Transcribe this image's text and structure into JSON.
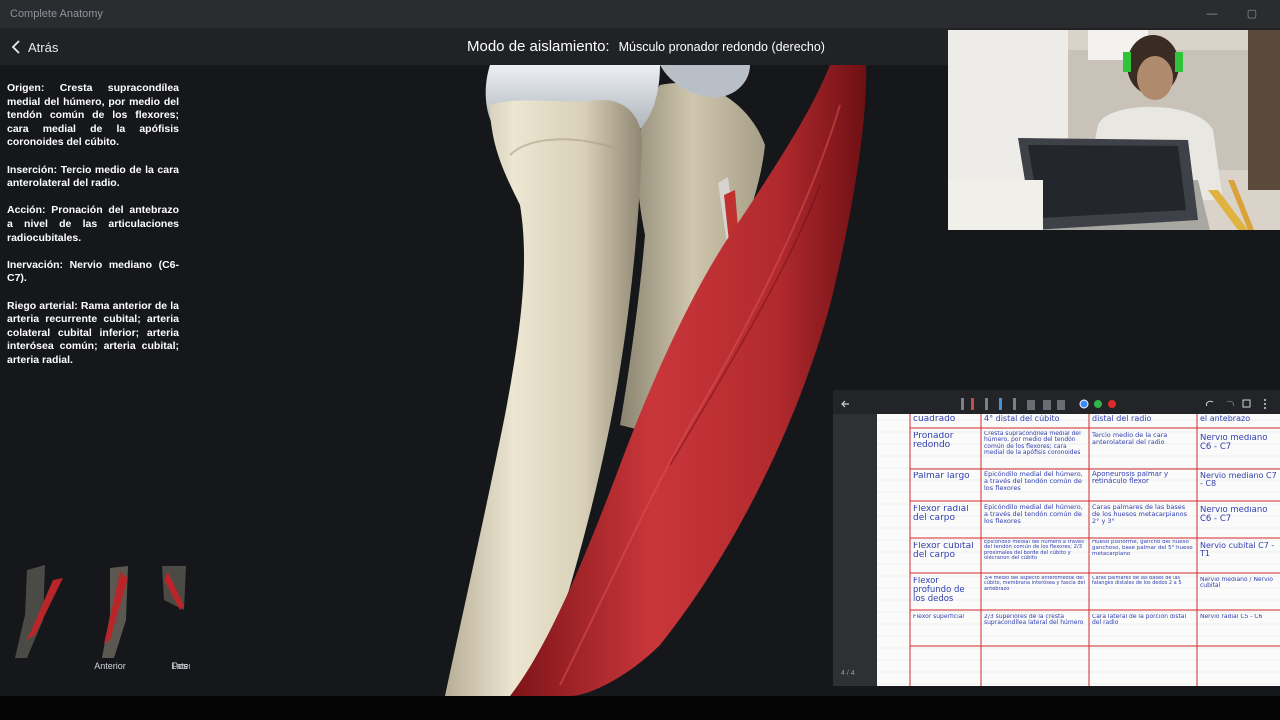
{
  "app_title": "Complete Anatomy",
  "window_controls": {
    "minimize": "—",
    "restore": "▢"
  },
  "header": {
    "back_label": "Atrás",
    "mode_label": "Modo de aislamiento:",
    "structure_label": "Músculo pronador redondo (derecho)"
  },
  "info_panel": [
    "Origen: Cresta supracondílea medial del húmero, por medio del tendón común de los flexores; cara medial de la apófisis coronoides del cúbito.",
    "Inserción: Tercio medio de la cara anterolateral del radio.",
    "Acción: Pronación del antebrazo a nivel de las articulaciones radiocubitales.",
    "Inervación: Nervio mediano (C6-C7).",
    "Riego arterial: Rama anterior de la arteria recurrente cubital; arteria colateral cubital inferior; arteria interósea común; arteria cubital; arteria radial."
  ],
  "thumbnails": [
    {
      "label": "Anterior"
    },
    {
      "label": "Lateral"
    },
    {
      "label": "Pos"
    }
  ],
  "notes": {
    "page_indicator": "4 / 4",
    "table_rows": [
      [
        "cuadrado",
        "4° distal del cúbito",
        "distal del radio",
        "el antebrazo"
      ],
      [
        "Pronador redondo",
        "Cresta supracondílea medial del húmero, por medio del tendón común de los flexores; cara medial de la apófisis coronoides",
        "Tercio medio de la cara anterolateral del radio",
        "Nervio mediano C6 - C7"
      ],
      [
        "Palmar largo",
        "Epicóndilo medial del húmero, a través del tendón común de los flexores",
        "Aponeurosis palmar y retináculo flexor",
        "Nervio mediano C7 - C8"
      ],
      [
        "Flexor radial del carpo",
        "Epicóndilo medial del húmero, a través del tendón común de los flexores",
        "Caras palmares de las bases de los huesos metacarpianos 2° y 3°",
        "Nervio mediano C6 - C7"
      ],
      [
        "Flexor cubital del carpo",
        "Epicóndilo medial del húmero a través del tendón común de los flexores; 2/3 proximales del borde del cúbito y olécranon del cúbito",
        "Hueso pisiforme, gancho del hueso ganchoso, base palmar del 5° hueso metacarpiano",
        "Nervio cubital C7 - T1"
      ],
      [
        "Flexor profundo de los dedos",
        "3/4 medio del aspecto anteromedial del cúbito, membrana interósea y fascia del antebrazo",
        "Caras palmares de las bases de las falanges distales de los dedos 2 a 5",
        "Nervio mediano / Nervio cubital"
      ],
      [
        "Flexor superficial",
        "2/3 superiores de la cresta supracondílea lateral del húmero",
        "Cara lateral de la porción distal del radio",
        "Nervio radial C5 - C6"
      ]
    ]
  },
  "colors": {
    "background": "#15171b",
    "topbar": "#202226",
    "muscle": "#b8262a",
    "bone": "#e6dfc9",
    "ink": "#2f3eb0",
    "grid_red": "#d12a2a"
  }
}
